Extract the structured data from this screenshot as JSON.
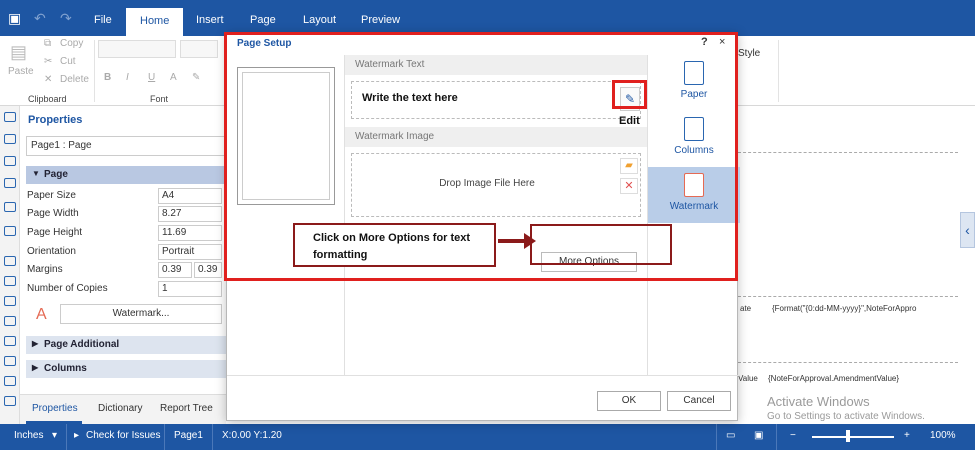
{
  "menu": {
    "tabs": [
      {
        "label": "File"
      },
      {
        "label": "Home",
        "active": true
      },
      {
        "label": "Insert"
      },
      {
        "label": "Page"
      },
      {
        "label": "Layout"
      },
      {
        "label": "Preview"
      }
    ]
  },
  "ribbon": {
    "paste": "Paste",
    "copy": "Copy",
    "cut": "Cut",
    "delete": "Delete",
    "clipboard_label": "Clipboard",
    "font_label": "Font",
    "bold": "B",
    "italic": "I",
    "underline": "U",
    "style_partial": "Style"
  },
  "properties": {
    "title": "Properties",
    "selector": "Page1 : Page",
    "section_page": "Page",
    "rows": [
      {
        "label": "Paper Size",
        "value": "A4"
      },
      {
        "label": "Page Width",
        "value": "8.27"
      },
      {
        "label": "Page Height",
        "value": "11.69"
      },
      {
        "label": "Orientation",
        "value": "Portrait"
      },
      {
        "label": "Margins",
        "value": "0.39"
      },
      {
        "label": "Number of Copies",
        "value": "1"
      }
    ],
    "margins_value_2": "0.39",
    "watermark_button": "Watermark...",
    "watermark_icon_letter": "A",
    "section_page_additional": "Page Additional",
    "section_columns": "Columns",
    "bottom_tabs": [
      "Properties",
      "Dictionary",
      "Report Tree"
    ]
  },
  "dialog": {
    "title": "Page Setup",
    "help": "?",
    "close": "×",
    "watermark_text_label": "Watermark Text",
    "watermark_text_value": "Write the text here",
    "watermark_image_label": "Watermark Image",
    "drop_hint": "Drop Image File Here",
    "more_options": "More Options",
    "nav": [
      {
        "label": "Paper"
      },
      {
        "label": "Columns"
      },
      {
        "label": "Watermark",
        "active": true
      }
    ],
    "ok": "OK",
    "cancel": "Cancel"
  },
  "annotations": {
    "edit_label": "Edit",
    "callout_text": "Click on More Options for text formatting"
  },
  "designer": {
    "cell_1": "ate",
    "cell_2": "{Format(\"{0:dd-MM-yyyy}\",NoteForAppro",
    "cell_3": "Value",
    "cell_4": "{NoteForApproval.AmendmentValue}"
  },
  "watermark_notice": {
    "line1": "Activate Windows",
    "line2": "Go to Settings to activate Windows."
  },
  "statusbar": {
    "units": "Inches",
    "check_issues": "Check for Issues",
    "page": "Page1",
    "coords": "X:0.00 Y:1.20",
    "zoom": "100%",
    "minus": "−",
    "plus": "+"
  },
  "colors": {
    "brand": "#1e56a3",
    "annotation_red": "#e0201e",
    "annotation_dark_red": "#8b1a1a"
  }
}
